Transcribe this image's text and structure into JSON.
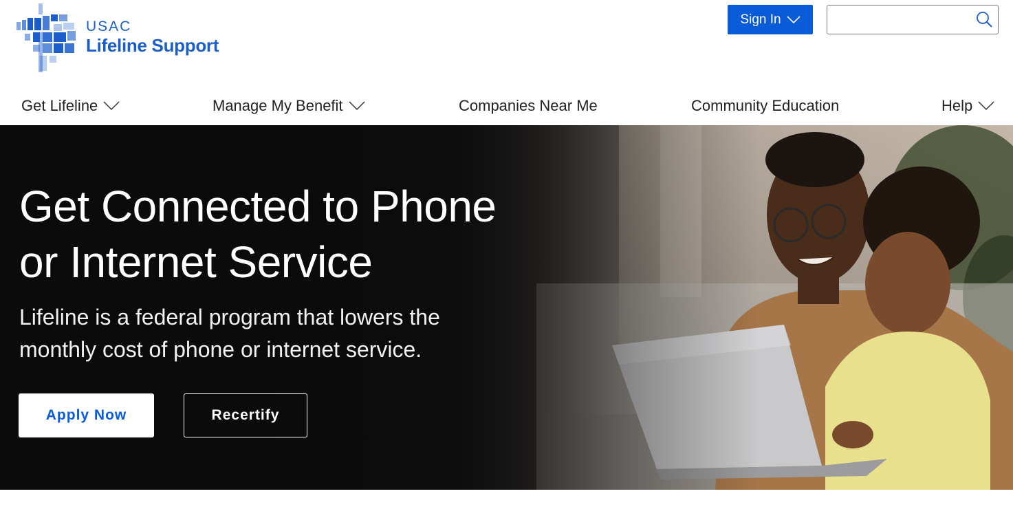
{
  "brand": {
    "org": "USAC",
    "name": "Lifeline Support",
    "color": "#1b5ec9",
    "icon": "usac-pixel-mark-icon"
  },
  "header": {
    "signin_label": "Sign In",
    "signin_icon": "chevron-down-icon",
    "search": {
      "value": "",
      "placeholder": "",
      "icon": "search-icon"
    }
  },
  "nav": {
    "items": [
      {
        "label": "Get Lifeline",
        "has_dropdown": true
      },
      {
        "label": "Manage My Benefit",
        "has_dropdown": true
      },
      {
        "label": "Companies Near Me",
        "has_dropdown": false
      },
      {
        "label": "Community Education",
        "has_dropdown": false
      },
      {
        "label": "Help",
        "has_dropdown": true
      }
    ]
  },
  "hero": {
    "title": "Get Connected to Phone or Internet Service",
    "subtitle": "Lifeline is a federal program that lowers the monthly cost of phone or internet service.",
    "primary_button": "Apply Now",
    "secondary_button": "Recertify",
    "image": "father-and-child-using-laptop"
  },
  "colors": {
    "accent": "#0a5bd8",
    "hero_background": "#0d0d0d",
    "text_dark": "#222222"
  }
}
